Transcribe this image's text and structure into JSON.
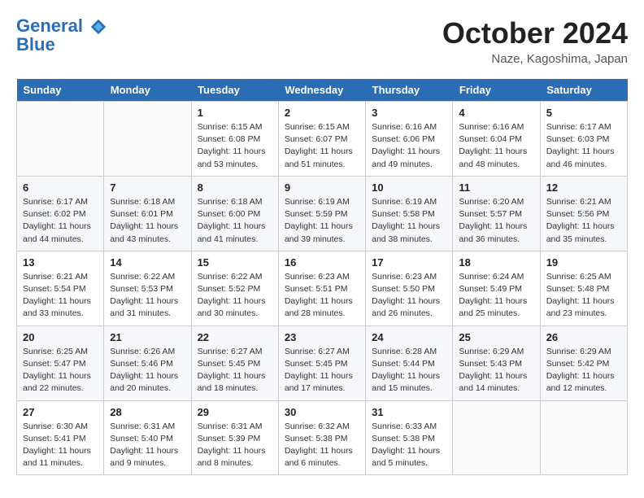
{
  "header": {
    "logo_line1": "General",
    "logo_line2": "Blue",
    "month_title": "October 2024",
    "location": "Naze, Kagoshima, Japan"
  },
  "weekdays": [
    "Sunday",
    "Monday",
    "Tuesday",
    "Wednesday",
    "Thursday",
    "Friday",
    "Saturday"
  ],
  "weeks": [
    [
      {
        "day": "",
        "sunrise": "",
        "sunset": "",
        "daylight": ""
      },
      {
        "day": "",
        "sunrise": "",
        "sunset": "",
        "daylight": ""
      },
      {
        "day": "1",
        "sunrise": "Sunrise: 6:15 AM",
        "sunset": "Sunset: 6:08 PM",
        "daylight": "Daylight: 11 hours and 53 minutes."
      },
      {
        "day": "2",
        "sunrise": "Sunrise: 6:15 AM",
        "sunset": "Sunset: 6:07 PM",
        "daylight": "Daylight: 11 hours and 51 minutes."
      },
      {
        "day": "3",
        "sunrise": "Sunrise: 6:16 AM",
        "sunset": "Sunset: 6:06 PM",
        "daylight": "Daylight: 11 hours and 49 minutes."
      },
      {
        "day": "4",
        "sunrise": "Sunrise: 6:16 AM",
        "sunset": "Sunset: 6:04 PM",
        "daylight": "Daylight: 11 hours and 48 minutes."
      },
      {
        "day": "5",
        "sunrise": "Sunrise: 6:17 AM",
        "sunset": "Sunset: 6:03 PM",
        "daylight": "Daylight: 11 hours and 46 minutes."
      }
    ],
    [
      {
        "day": "6",
        "sunrise": "Sunrise: 6:17 AM",
        "sunset": "Sunset: 6:02 PM",
        "daylight": "Daylight: 11 hours and 44 minutes."
      },
      {
        "day": "7",
        "sunrise": "Sunrise: 6:18 AM",
        "sunset": "Sunset: 6:01 PM",
        "daylight": "Daylight: 11 hours and 43 minutes."
      },
      {
        "day": "8",
        "sunrise": "Sunrise: 6:18 AM",
        "sunset": "Sunset: 6:00 PM",
        "daylight": "Daylight: 11 hours and 41 minutes."
      },
      {
        "day": "9",
        "sunrise": "Sunrise: 6:19 AM",
        "sunset": "Sunset: 5:59 PM",
        "daylight": "Daylight: 11 hours and 39 minutes."
      },
      {
        "day": "10",
        "sunrise": "Sunrise: 6:19 AM",
        "sunset": "Sunset: 5:58 PM",
        "daylight": "Daylight: 11 hours and 38 minutes."
      },
      {
        "day": "11",
        "sunrise": "Sunrise: 6:20 AM",
        "sunset": "Sunset: 5:57 PM",
        "daylight": "Daylight: 11 hours and 36 minutes."
      },
      {
        "day": "12",
        "sunrise": "Sunrise: 6:21 AM",
        "sunset": "Sunset: 5:56 PM",
        "daylight": "Daylight: 11 hours and 35 minutes."
      }
    ],
    [
      {
        "day": "13",
        "sunrise": "Sunrise: 6:21 AM",
        "sunset": "Sunset: 5:54 PM",
        "daylight": "Daylight: 11 hours and 33 minutes."
      },
      {
        "day": "14",
        "sunrise": "Sunrise: 6:22 AM",
        "sunset": "Sunset: 5:53 PM",
        "daylight": "Daylight: 11 hours and 31 minutes."
      },
      {
        "day": "15",
        "sunrise": "Sunrise: 6:22 AM",
        "sunset": "Sunset: 5:52 PM",
        "daylight": "Daylight: 11 hours and 30 minutes."
      },
      {
        "day": "16",
        "sunrise": "Sunrise: 6:23 AM",
        "sunset": "Sunset: 5:51 PM",
        "daylight": "Daylight: 11 hours and 28 minutes."
      },
      {
        "day": "17",
        "sunrise": "Sunrise: 6:23 AM",
        "sunset": "Sunset: 5:50 PM",
        "daylight": "Daylight: 11 hours and 26 minutes."
      },
      {
        "day": "18",
        "sunrise": "Sunrise: 6:24 AM",
        "sunset": "Sunset: 5:49 PM",
        "daylight": "Daylight: 11 hours and 25 minutes."
      },
      {
        "day": "19",
        "sunrise": "Sunrise: 6:25 AM",
        "sunset": "Sunset: 5:48 PM",
        "daylight": "Daylight: 11 hours and 23 minutes."
      }
    ],
    [
      {
        "day": "20",
        "sunrise": "Sunrise: 6:25 AM",
        "sunset": "Sunset: 5:47 PM",
        "daylight": "Daylight: 11 hours and 22 minutes."
      },
      {
        "day": "21",
        "sunrise": "Sunrise: 6:26 AM",
        "sunset": "Sunset: 5:46 PM",
        "daylight": "Daylight: 11 hours and 20 minutes."
      },
      {
        "day": "22",
        "sunrise": "Sunrise: 6:27 AM",
        "sunset": "Sunset: 5:45 PM",
        "daylight": "Daylight: 11 hours and 18 minutes."
      },
      {
        "day": "23",
        "sunrise": "Sunrise: 6:27 AM",
        "sunset": "Sunset: 5:45 PM",
        "daylight": "Daylight: 11 hours and 17 minutes."
      },
      {
        "day": "24",
        "sunrise": "Sunrise: 6:28 AM",
        "sunset": "Sunset: 5:44 PM",
        "daylight": "Daylight: 11 hours and 15 minutes."
      },
      {
        "day": "25",
        "sunrise": "Sunrise: 6:29 AM",
        "sunset": "Sunset: 5:43 PM",
        "daylight": "Daylight: 11 hours and 14 minutes."
      },
      {
        "day": "26",
        "sunrise": "Sunrise: 6:29 AM",
        "sunset": "Sunset: 5:42 PM",
        "daylight": "Daylight: 11 hours and 12 minutes."
      }
    ],
    [
      {
        "day": "27",
        "sunrise": "Sunrise: 6:30 AM",
        "sunset": "Sunset: 5:41 PM",
        "daylight": "Daylight: 11 hours and 11 minutes."
      },
      {
        "day": "28",
        "sunrise": "Sunrise: 6:31 AM",
        "sunset": "Sunset: 5:40 PM",
        "daylight": "Daylight: 11 hours and 9 minutes."
      },
      {
        "day": "29",
        "sunrise": "Sunrise: 6:31 AM",
        "sunset": "Sunset: 5:39 PM",
        "daylight": "Daylight: 11 hours and 8 minutes."
      },
      {
        "day": "30",
        "sunrise": "Sunrise: 6:32 AM",
        "sunset": "Sunset: 5:38 PM",
        "daylight": "Daylight: 11 hours and 6 minutes."
      },
      {
        "day": "31",
        "sunrise": "Sunrise: 6:33 AM",
        "sunset": "Sunset: 5:38 PM",
        "daylight": "Daylight: 11 hours and 5 minutes."
      },
      {
        "day": "",
        "sunrise": "",
        "sunset": "",
        "daylight": ""
      },
      {
        "day": "",
        "sunrise": "",
        "sunset": "",
        "daylight": ""
      }
    ]
  ]
}
